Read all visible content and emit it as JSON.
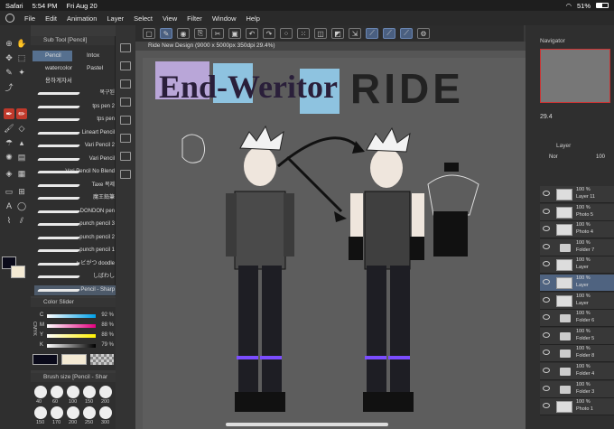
{
  "status": {
    "app": "Safari",
    "time": "5:54 PM",
    "date": "Fri Aug 20",
    "battery": "51%",
    "battery_level": 0.51
  },
  "menu": [
    "File",
    "Edit",
    "Animation",
    "Layer",
    "Select",
    "View",
    "Filter",
    "Window",
    "Help"
  ],
  "document_tab": "Ride New Design (9000 x 5000px 350dpi 29.4%)",
  "subtool": {
    "title": "Sub Tool [Pencil]",
    "categories": [
      "Pencil",
      "Intox",
      "watercolor",
      "Pastel",
      "용하게자서"
    ],
    "brushes": [
      "복구된",
      "tps pen 2",
      "tps pen",
      "Lineart Pencil",
      "Vari Pencil 2",
      "Vari Pencil",
      "Vari Pencil No Blend",
      "Taxe 복제",
      "魔王鉛筆",
      "DONDON pen",
      "punch pencil 3",
      "punch pencil 2",
      "punch pencil 1",
      "ヶビがつ doodle",
      "しばわし",
      "Pencil - Sharp"
    ]
  },
  "color_slider": {
    "title": "Color Slider",
    "channels": [
      {
        "label": "C",
        "value": "92 %"
      },
      {
        "label": "M",
        "value": "88 %"
      },
      {
        "label": "Y",
        "value": "88 %"
      },
      {
        "label": "K",
        "value": "79 %"
      }
    ],
    "side_label": "CMYK"
  },
  "brush_size": {
    "title": "Brush size [Pencil - Shar",
    "sizes": [
      "40",
      "60",
      "100",
      "150",
      "200",
      "250",
      "300",
      "350",
      "400"
    ],
    "labels_bottom": [
      "150",
      "170",
      "200",
      "250",
      "300"
    ]
  },
  "navigator": {
    "title": "Navigator",
    "zoom": "29.4"
  },
  "layer_panel": {
    "title": "Layer",
    "blend": "Nor",
    "opacity": "100",
    "layers": [
      {
        "pct": "100 %",
        "name": "Layer 11",
        "kind": "layer"
      },
      {
        "pct": "100 %",
        "name": "Photo 5",
        "kind": "layer"
      },
      {
        "pct": "100 %",
        "name": "Photo 4",
        "kind": "layer"
      },
      {
        "pct": "100 %",
        "name": "Folder 7",
        "kind": "folder"
      },
      {
        "pct": "100 %",
        "name": "Layer",
        "kind": "layer"
      },
      {
        "pct": "100 %",
        "name": "Layer",
        "kind": "layer",
        "selected": true
      },
      {
        "pct": "100 %",
        "name": "Layer",
        "kind": "layer"
      },
      {
        "pct": "100 %",
        "name": "Folder 6",
        "kind": "folder"
      },
      {
        "pct": "100 %",
        "name": "Folder 5",
        "kind": "folder"
      },
      {
        "pct": "100 %",
        "name": "Folder 8",
        "kind": "folder"
      },
      {
        "pct": "100 %",
        "name": "Folder 4",
        "kind": "folder"
      },
      {
        "pct": "100 %",
        "name": "Folder 3",
        "kind": "folder"
      },
      {
        "pct": "100 %",
        "name": "Photo 1",
        "kind": "layer"
      }
    ]
  },
  "artwork": {
    "title_left": "End-Weritor",
    "title_right": "RIDE"
  }
}
